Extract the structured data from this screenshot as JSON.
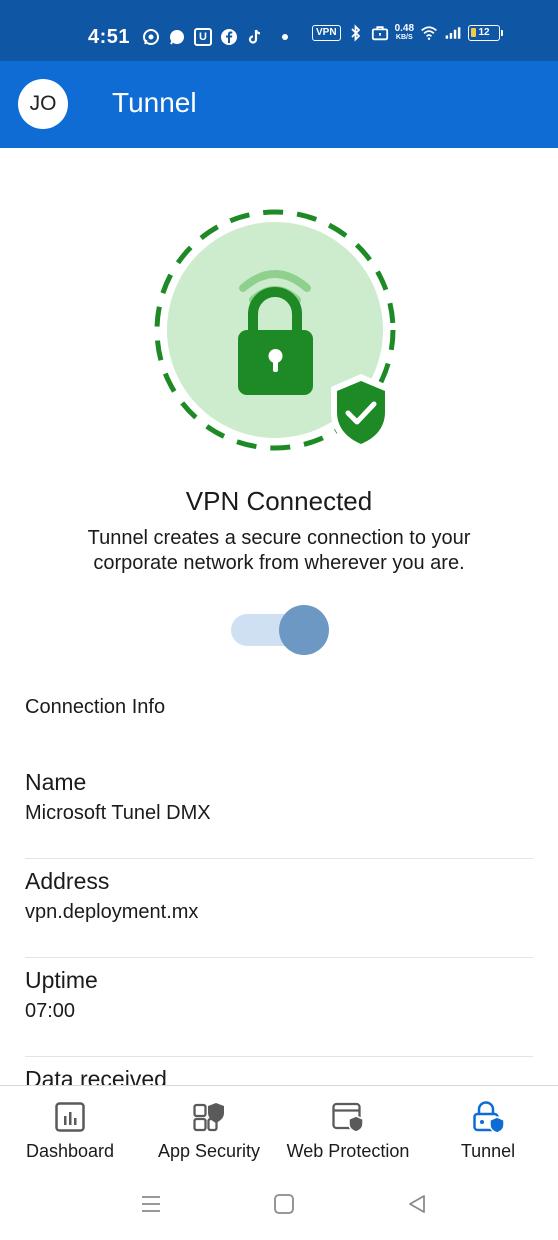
{
  "status_bar": {
    "time": "4:51",
    "vpn_badge": "VPN",
    "speed_value": "0.48",
    "speed_unit": "KB/S",
    "battery_level": "12",
    "icons": [
      "whatsapp-icon",
      "signal-icon",
      "u-app-icon",
      "facebook-icon",
      "tiktok-icon",
      "dot-icon",
      "vpn-icon",
      "bluetooth-icon",
      "briefcase-icon",
      "wifi-icon",
      "cellular-icon",
      "battery-icon"
    ]
  },
  "app_bar": {
    "avatar_initials": "JO",
    "title": "Tunnel"
  },
  "hero": {
    "icons": [
      "wifi-waves-icon",
      "padlock-icon",
      "shield-check-icon"
    ],
    "colors": {
      "ring": "#1e8a26",
      "fill": "#cdeccd",
      "lock": "#1e8a26",
      "shield": "#1e8a26"
    }
  },
  "vpn": {
    "status": "VPN Connected",
    "description": "Tunnel creates a secure connection to your corporate network from wherever you are.",
    "toggle_on": true
  },
  "connection_info": {
    "title": "Connection Info",
    "items": [
      {
        "label": "Name",
        "value": "Microsoft Tunel DMX"
      },
      {
        "label": "Address",
        "value": "vpn.deployment.mx"
      },
      {
        "label": "Uptime",
        "value": "07:00"
      },
      {
        "label": "Data received",
        "value": ""
      }
    ]
  },
  "bottom_nav": {
    "items": [
      {
        "label": "Dashboard",
        "icon": "dashboard-chart-icon",
        "active": false
      },
      {
        "label": "App Security",
        "icon": "app-security-icon",
        "active": false
      },
      {
        "label": "Web Protection",
        "icon": "web-protection-icon",
        "active": false
      },
      {
        "label": "Tunnel",
        "icon": "tunnel-lock-icon",
        "active": true
      }
    ],
    "active_color": "#0f6cd4"
  },
  "system_nav": {
    "icons": [
      "menu-icon",
      "home-icon",
      "back-icon"
    ]
  }
}
